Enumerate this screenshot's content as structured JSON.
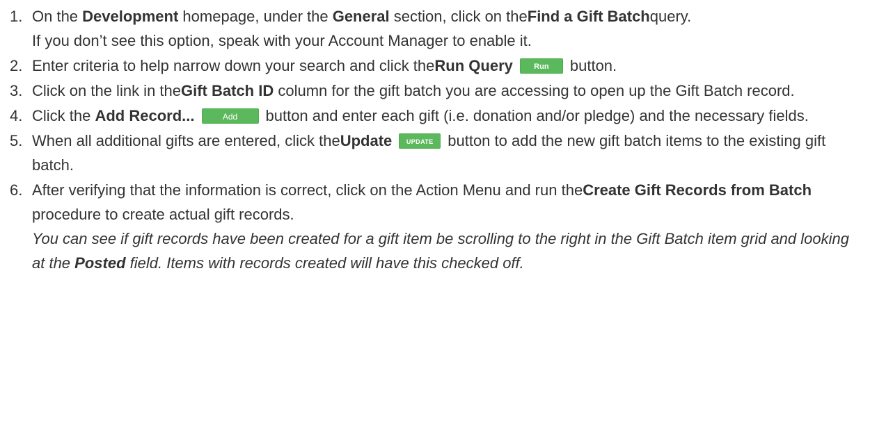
{
  "steps": [
    {
      "number": "1.",
      "t1": "On the ",
      "b1": "Development",
      "t2": " homepage, under the ",
      "b2": "General",
      "t3": " section, click on the",
      "b3": "Find a Gift Batch",
      "t4": "query.",
      "line2": "If you don’t see this option, speak with your Account Manager to enable it."
    },
    {
      "number": "2.",
      "t1": "Enter criteria to help narrow down your search and click the",
      "b1": "Run Query",
      "button": "Run Query",
      "t2": "button."
    },
    {
      "number": "3.",
      "t1": "Click on the link in the",
      "b1": "Gift Batch ID",
      "t2": " column for the gift batch you are accessing to open up the Gift Batch record."
    },
    {
      "number": "4.",
      "t1": "Click the ",
      "b1": "Add Record...",
      "button": "Add Record...",
      "t2": "button and enter each gift (i.e. donation and/or pledge) and the necessary fields."
    },
    {
      "number": "5.",
      "t1": "When all additional gifts are entered, click the",
      "b1": "Update",
      "button": "UPDATE",
      "t2": "button to add the new gift batch items to the existing gift batch."
    },
    {
      "number": "6.",
      "t1": "After verifying that the information is correct, click on the Action Menu and run the",
      "b1": "Create Gift Records from Batch",
      "t2": " procedure to create actual gift records.",
      "note_t1": "You can see if gift records have been created for a gift item be scrolling to the right in the Gift Batch item grid and looking at the ",
      "note_b1": "Posted",
      "note_t2": " field. Items with records created will have this checked off."
    }
  ]
}
